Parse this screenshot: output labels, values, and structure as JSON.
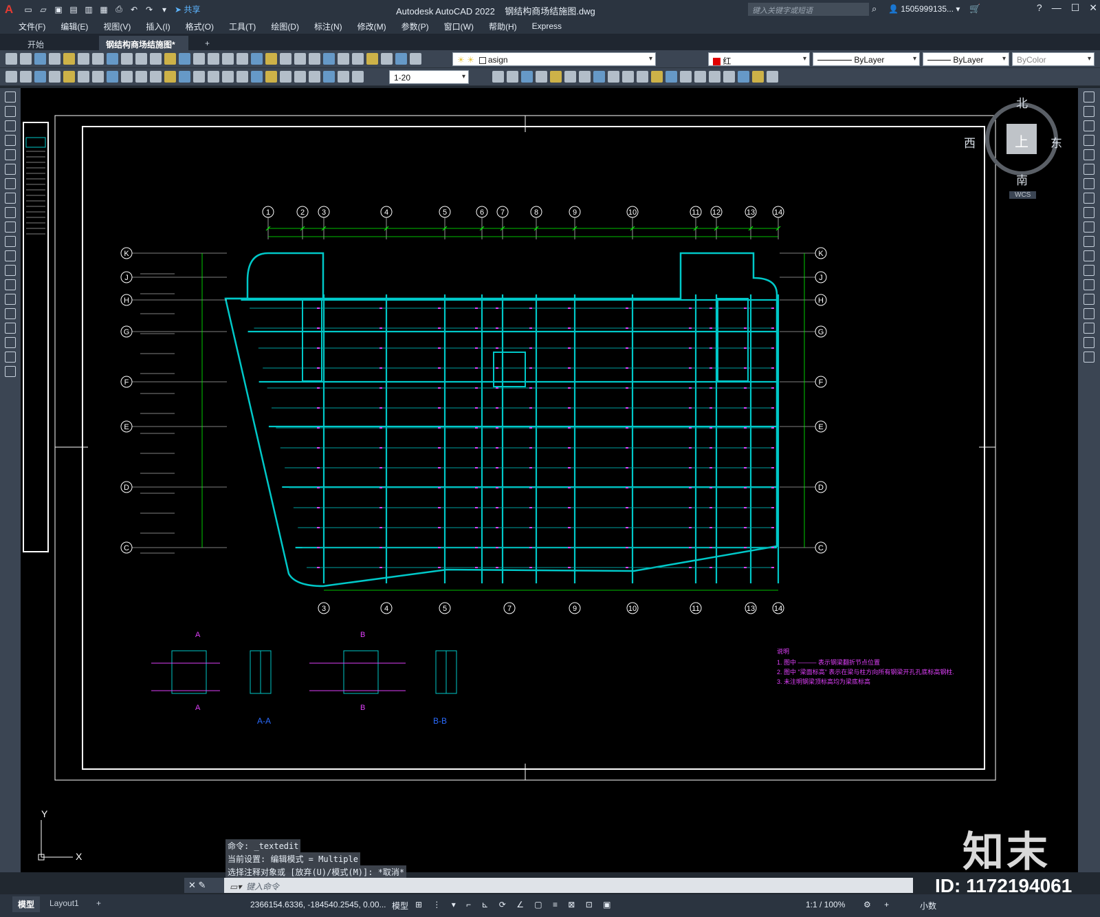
{
  "titlebar": {
    "app_name": "Autodesk AutoCAD 2022",
    "file_name": "钢结构商场结施图.dwg",
    "share_label": "共享",
    "search_placeholder": "键入关键字或短语",
    "user": "1505999135...",
    "app_logo": "A"
  },
  "menu": [
    "文件(F)",
    "编辑(E)",
    "视图(V)",
    "插入(I)",
    "格式(O)",
    "工具(T)",
    "绘图(D)",
    "标注(N)",
    "修改(M)",
    "参数(P)",
    "窗口(W)",
    "帮助(H)",
    "Express"
  ],
  "tabs": {
    "start": "开始",
    "drawing": "钢结构商场结施图*"
  },
  "properties": {
    "layer": "asign",
    "color": "红",
    "linetype": "ByLayer",
    "lineweight": "ByLayer",
    "plotstyle": "ByColor",
    "scale": "1-20"
  },
  "viewcube": {
    "north": "北",
    "south": "南",
    "east": "东",
    "west": "西",
    "top": "上",
    "wcs": "WCS"
  },
  "drawing": {
    "grid_cols_top": [
      "1",
      "2",
      "3",
      "4",
      "5",
      "6",
      "7",
      "8",
      "9",
      "10",
      "11",
      "12",
      "13",
      "14"
    ],
    "grid_cols_bottom": [
      "3",
      "4",
      "5",
      "7",
      "9",
      "10",
      "11",
      "13",
      "14"
    ],
    "grid_rows": [
      "K",
      "J",
      "H",
      "G",
      "F",
      "E",
      "D",
      "C"
    ],
    "sections": [
      "A-A",
      "B-B"
    ],
    "section_marks": [
      "A",
      "A",
      "B",
      "B"
    ],
    "notes_title": "说明",
    "notes": [
      "1.  图中 ——— 表示钢梁翻折节点位置",
      "2.  图中 \"梁面标高\" 表示在梁与柱方向所有钢梁开孔孔底标高钢柱.",
      "3.  未注明钢梁顶标高均为梁底标高"
    ]
  },
  "command": {
    "history": [
      "命令: _textedit",
      "当前设置: 编辑模式 = Multiple",
      "选择注释对象或 [放弃(U)/模式(M)]: *取消*"
    ],
    "placeholder": "键入命令"
  },
  "status": {
    "model_tab": "模型",
    "layout_tab": "Layout1",
    "coords": "2366154.6336, -184540.2545, 0.00...",
    "space": "模型",
    "scale": "1:1 / 100%",
    "units": "小数"
  },
  "watermark": {
    "logo": "知末",
    "id": "ID: 1172194061"
  },
  "colors": {
    "frame": "#2b3440",
    "toolbar": "#3b4553",
    "canvas": "#000000",
    "beam": "#00c8c8",
    "dim": "#00ff00",
    "annot": "#e040fb"
  }
}
